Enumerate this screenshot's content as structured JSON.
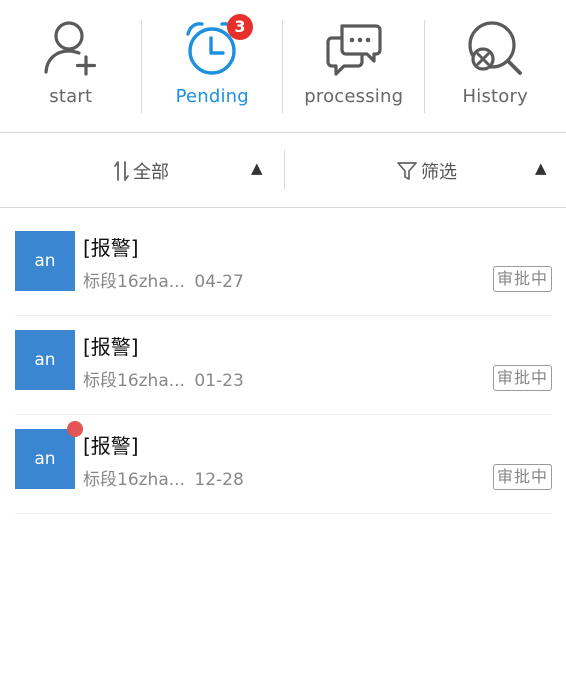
{
  "tabs": [
    {
      "label": "start",
      "icon": "add-user-icon",
      "active": false
    },
    {
      "label": "Pending",
      "icon": "alarm-clock-icon",
      "active": true,
      "badge": "3"
    },
    {
      "label": "processing",
      "icon": "chat-bubbles-icon",
      "active": false
    },
    {
      "label": "History",
      "icon": "search-history-icon",
      "active": false
    }
  ],
  "filter": {
    "sort_label": "全部",
    "sort_arrow": "▲",
    "filter_label": "筛选",
    "filter_arrow": "▲"
  },
  "items": [
    {
      "avatar": "an",
      "title": "[报警]",
      "subtitle": "标段16zha...",
      "date": "04-27",
      "status": "审批中",
      "unread": false
    },
    {
      "avatar": "an",
      "title": "[报警]",
      "subtitle": "标段16zha...",
      "date": "01-23",
      "status": "审批中",
      "unread": false
    },
    {
      "avatar": "an",
      "title": "[报警]",
      "subtitle": "标段16zha...",
      "date": "12-28",
      "status": "审批中",
      "unread": true
    }
  ],
  "colors": {
    "accent": "#1e90e0",
    "avatar_bg": "#3a86d0",
    "badge": "#e8302a",
    "unread_dot": "#e25656"
  }
}
